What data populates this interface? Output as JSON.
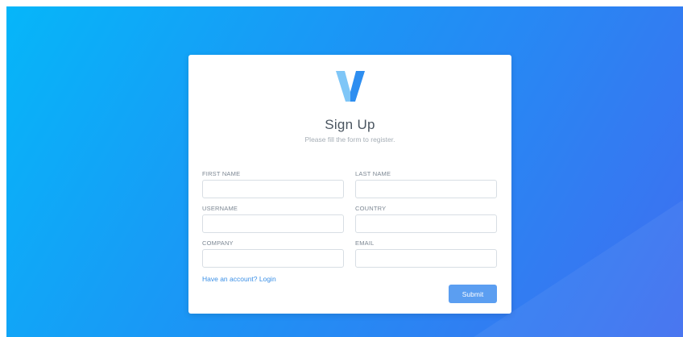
{
  "brand": {
    "logo_letter": "V",
    "logo_colors": {
      "left": "#7fc6f7",
      "right": "#2e8ef0"
    }
  },
  "form": {
    "title": "Sign Up",
    "subtitle": "Please fill the form to register.",
    "fields": {
      "first_name": {
        "label": "FIRST NAME",
        "value": "",
        "placeholder": ""
      },
      "last_name": {
        "label": "LAST NAME",
        "value": "",
        "placeholder": ""
      },
      "username": {
        "label": "USERNAME",
        "value": "",
        "placeholder": ""
      },
      "country": {
        "label": "COUNTRY",
        "value": "",
        "placeholder": ""
      },
      "company": {
        "label": "COMPANY",
        "value": "",
        "placeholder": ""
      },
      "email": {
        "label": "EMAIL",
        "value": "",
        "placeholder": ""
      }
    },
    "login_link": "Have an account? Login",
    "submit_label": "Submit"
  },
  "colors": {
    "background_start": "#06b6f9",
    "background_end": "#3f6ef0",
    "accent": "#5b9ef1",
    "link": "#3a8fe6"
  }
}
